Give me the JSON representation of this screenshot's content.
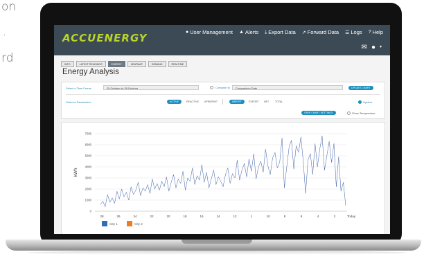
{
  "background_text": [
    "on",
    ".",
    "rd"
  ],
  "app": {
    "logo": "ACCUENERGY",
    "nav": [
      {
        "label": "User Management",
        "icon": "user-icon"
      },
      {
        "label": "Alerts",
        "icon": "warning-icon"
      },
      {
        "label": "Export Data",
        "icon": "download-icon"
      },
      {
        "label": "Forward Data",
        "icon": "share-icon"
      },
      {
        "label": "Logs",
        "icon": "list-icon"
      },
      {
        "label": "Help",
        "icon": "question-icon"
      }
    ],
    "nav_icons": [
      "mail-icon",
      "user-icon",
      "caret-down-icon"
    ]
  },
  "tabs": [
    {
      "label": "INFO",
      "active": false
    },
    {
      "label": "LATEST READINGS",
      "active": false
    },
    {
      "label": "ENERGY",
      "active": true
    },
    {
      "label": "HEATMAP",
      "active": false
    },
    {
      "label": "DEMAND",
      "active": false
    },
    {
      "label": "REALTIME",
      "active": false
    }
  ],
  "page_title": "Energy Analysis",
  "controls": {
    "time_frame_label": "Select a Time Frame",
    "time_frame_value": "25 October to 28 October",
    "compare_label": "Compare to",
    "compare_placeholder": "Comparison Date",
    "update_button": "UPDATE CHART",
    "parameters_label": "Select a Parameters",
    "param_pills": [
      {
        "label": "ACTIVE",
        "on": true
      },
      {
        "label": "REACTIVE",
        "on": false
      },
      {
        "label": "APPARENT",
        "on": false
      }
    ],
    "flow_pills": [
      {
        "label": "IMPORT",
        "on": true
      },
      {
        "label": "EXPORT",
        "on": false
      },
      {
        "label": "NET",
        "on": false
      },
      {
        "label": "TOTAL",
        "on": false
      }
    ],
    "system_label": "System",
    "save_button": "SAVE CHART SETTINGS",
    "temperature_label": "Show Temperature"
  },
  "chart_data": {
    "type": "line",
    "ylabel": "kWh",
    "ylim": [
      0,
      7000
    ],
    "yticks": [
      "0",
      "1000",
      "2000",
      "3000",
      "4000",
      "5000",
      "6000",
      "7000"
    ],
    "xticks": [
      "28",
      "26",
      "24",
      "22",
      "20",
      "18",
      "16",
      "14",
      "12",
      "1",
      "10",
      "8",
      "6",
      "4",
      "2",
      "Today"
    ],
    "grid": true,
    "legend": [
      {
        "name": "City 1",
        "color": "#2f6fb3"
      },
      {
        "name": "City 2",
        "color": "#f07c1f"
      }
    ],
    "series": [
      {
        "name": "City 1",
        "color": "#3b5ea8",
        "values": [
          600,
          900,
          400,
          1500,
          800,
          1200,
          700,
          1800,
          1100,
          2000,
          1300,
          1700,
          1000,
          2200,
          1500,
          1900,
          2600,
          1400,
          2100,
          1800,
          2400,
          1600,
          2900,
          2000,
          2500,
          1900,
          2700,
          2200,
          3100,
          1800,
          2600,
          3300,
          2100,
          2900,
          2500,
          3600,
          1900,
          3000,
          2700,
          3900,
          2400,
          3200,
          2800,
          4200,
          2600,
          3500,
          2100,
          2900,
          3700,
          2400,
          3100,
          2700,
          2200,
          3300,
          3900,
          2500,
          3400,
          3000,
          4600,
          2800,
          3700,
          4300,
          3100,
          4700,
          3600,
          5200,
          2900,
          4000,
          4500,
          3500,
          5600,
          4100,
          3300,
          4800,
          5300,
          3900,
          4400,
          6600,
          2100,
          4000,
          5800,
          6400,
          3800,
          5900,
          5300,
          6700,
          4500,
          1600,
          4600,
          5200,
          3300,
          6100,
          4000,
          5600,
          6800,
          3700,
          5000,
          6300,
          4400,
          6100,
          2200,
          4900,
          1800,
          2600,
          500
        ]
      }
    ]
  }
}
